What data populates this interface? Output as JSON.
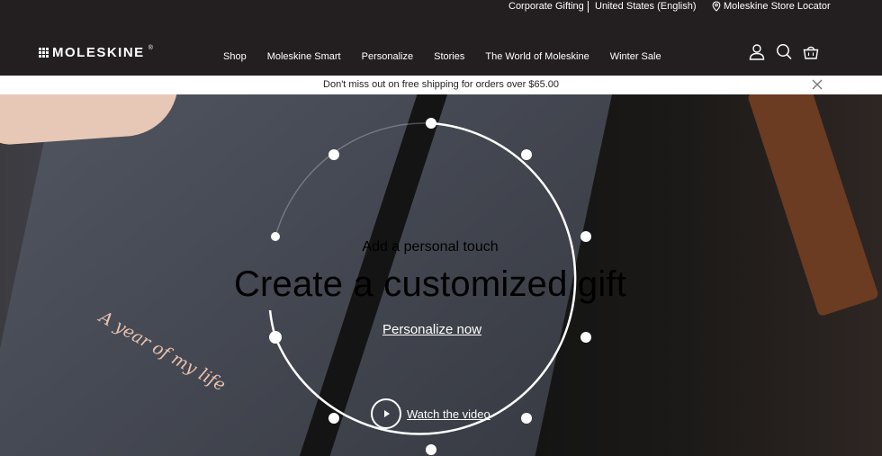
{
  "utility": {
    "corporate_gifting": "Corporate Gifting",
    "country": "United States (English)",
    "store_locator": "Moleskine Store Locator"
  },
  "header": {
    "logo_text": "MOLESKINE",
    "logo_mark": "®",
    "nav": [
      "Shop",
      "Moleskine Smart",
      "Personalize",
      "Stories",
      "The World of Moleskine",
      "Winter Sale"
    ],
    "icons": [
      "account-icon",
      "search-icon",
      "cart-icon"
    ]
  },
  "promo": {
    "text": "Don't miss out on free shipping for orders over $65.00"
  },
  "hero": {
    "notebook_print": "A year of my life",
    "subtitle": "Add a personal touch",
    "title": "Create a customized gift",
    "cta": "Personalize now",
    "video_label": "Watch the video"
  },
  "colors": {
    "header_bg": "#231f20",
    "text_light": "#ffffff",
    "banner_bg": "#ffffff"
  }
}
